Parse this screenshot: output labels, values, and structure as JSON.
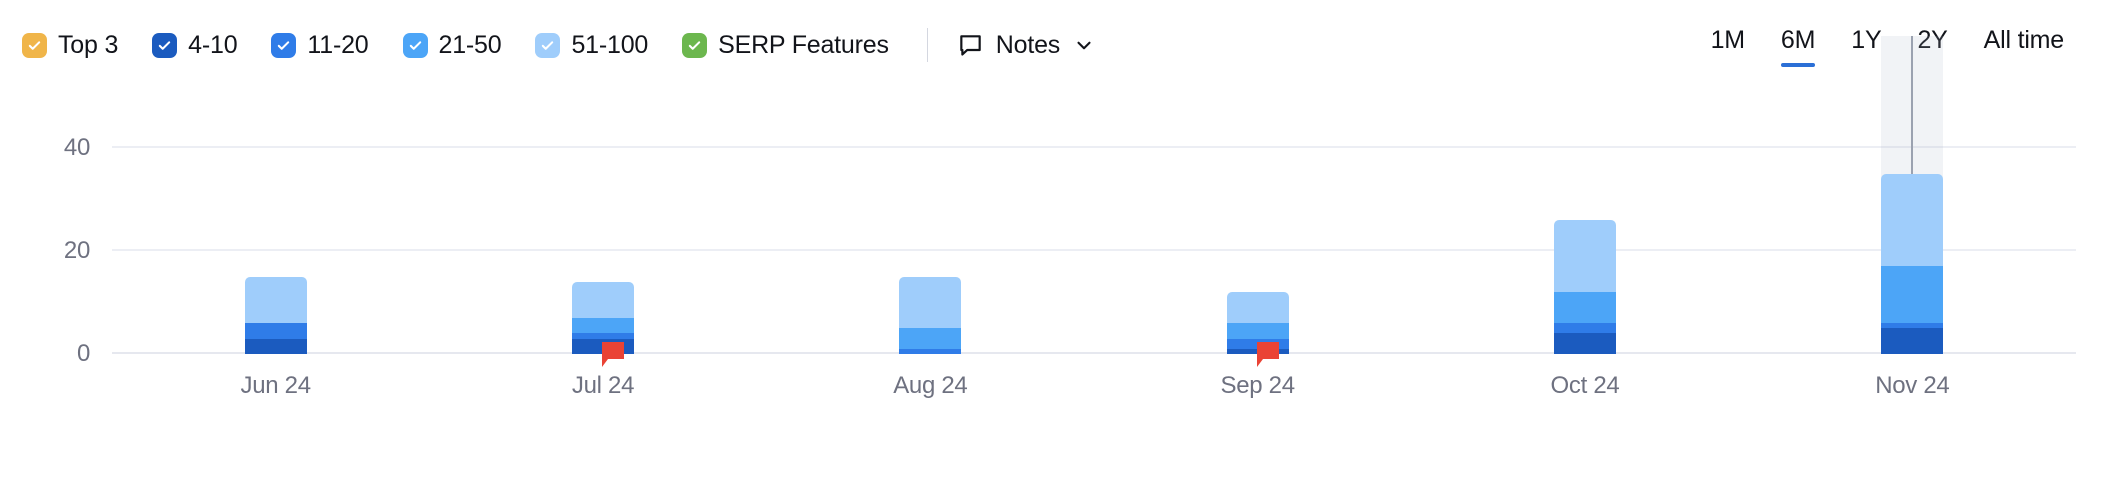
{
  "legend": {
    "items": [
      {
        "label": "Top 3",
        "color": "#f0b549",
        "checked": true,
        "icon": "checkbox-checked-icon"
      },
      {
        "label": "4-10",
        "color": "#1b5bbf",
        "checked": true,
        "icon": "checkbox-checked-icon"
      },
      {
        "label": "11-20",
        "color": "#2f7ce8",
        "checked": true,
        "icon": "checkbox-checked-icon"
      },
      {
        "label": "21-50",
        "color": "#4ca5f7",
        "checked": true,
        "icon": "checkbox-checked-icon"
      },
      {
        "label": "51-100",
        "color": "#9fcdfb",
        "checked": true,
        "icon": "checkbox-checked-icon"
      },
      {
        "label": "SERP Features",
        "color": "#6cb74e",
        "checked": true,
        "icon": "checkbox-checked-icon"
      }
    ]
  },
  "notes": {
    "label": "Notes",
    "icon": "comment-bubble-icon",
    "chevron": "chevron-down-icon"
  },
  "ranges": {
    "items": [
      {
        "label": "1M",
        "active": false
      },
      {
        "label": "6M",
        "active": true
      },
      {
        "label": "1Y",
        "active": false
      },
      {
        "label": "2Y",
        "active": false
      },
      {
        "label": "All time",
        "active": false
      }
    ],
    "active_color": "#2b6fd6"
  },
  "chart_data": {
    "type": "bar",
    "title": "",
    "xlabel": "",
    "ylabel": "",
    "stacked": true,
    "grid": true,
    "legend_position": "top-left",
    "ylim": [
      0,
      52
    ],
    "yticks": [
      0,
      20,
      40
    ],
    "ytick_labels": [
      "0",
      "20",
      "40"
    ],
    "categories": [
      "Jun 24",
      "Jul 24",
      "Aug 24",
      "Sep 24",
      "Oct 24",
      "Nov 24"
    ],
    "series": [
      {
        "name": "Top 3",
        "color": "#f0b549",
        "values": [
          0,
          0,
          0,
          0,
          0,
          0
        ]
      },
      {
        "name": "4-10",
        "color": "#1b5bbf",
        "values": [
          3,
          3,
          0,
          1,
          4,
          5
        ]
      },
      {
        "name": "11-20",
        "color": "#2f7ce8",
        "values": [
          3,
          1,
          1,
          2,
          2,
          1
        ]
      },
      {
        "name": "21-50",
        "color": "#4ca5f7",
        "values": [
          0,
          3,
          4,
          3,
          6,
          11
        ]
      },
      {
        "name": "51-100",
        "color": "#9fcdfb",
        "values": [
          9,
          7,
          10,
          6,
          14,
          18
        ]
      }
    ],
    "totals": [
      15,
      14,
      15,
      12,
      26,
      35
    ],
    "annotations": [
      {
        "type": "note-marker",
        "category": "Jul 24",
        "color": "#ea4335"
      },
      {
        "type": "note-marker",
        "category": "Sep 24",
        "color": "#ea4335"
      }
    ],
    "hover": {
      "category": "Nov 24",
      "crosshair": true
    }
  }
}
